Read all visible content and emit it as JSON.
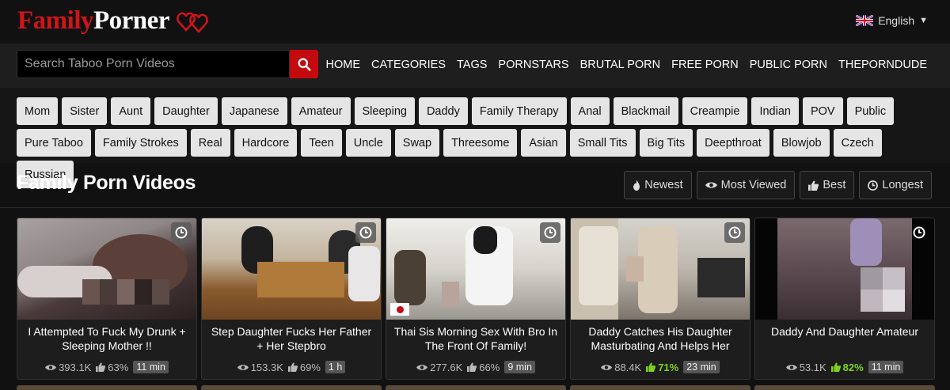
{
  "site": {
    "name_part1": "Family",
    "name_part2": "Porner",
    "language": "English"
  },
  "search": {
    "placeholder": "Search Taboo Porn Videos"
  },
  "nav": [
    "HOME",
    "CATEGORIES",
    "TAGS",
    "PORNSTARS",
    "BRUTAL PORN",
    "FREE PORN",
    "PUBLIC PORN",
    "THEPORNDUDE"
  ],
  "tags": [
    "Mom",
    "Sister",
    "Aunt",
    "Daughter",
    "Japanese",
    "Amateur",
    "Sleeping",
    "Daddy",
    "Family Therapy",
    "Anal",
    "Blackmail",
    "Creampie",
    "Indian",
    "POV",
    "Public",
    "Pure Taboo",
    "Family Strokes",
    "Real",
    "Hardcore",
    "Teen",
    "Uncle",
    "Swap",
    "Threesome",
    "Asian",
    "Small Tits",
    "Big Tits",
    "Deepthroat",
    "Blowjob",
    "Czech",
    "Russian"
  ],
  "section": {
    "title": "Family Porn Videos"
  },
  "sort": {
    "newest": "Newest",
    "most_viewed": "Most Viewed",
    "best": "Best",
    "longest": "Longest"
  },
  "videos": [
    {
      "title": "I Attempted To Fuck My Drunk + Sleeping Mother !!",
      "views": "393.1K",
      "rating": "63%",
      "duration": "11 min"
    },
    {
      "title": "Step Daughter Fucks Her Father + Her Stepbro",
      "views": "153.3K",
      "rating": "69%",
      "duration": "1 h"
    },
    {
      "title": "Thai Sis Morning Sex With Bro In The Front Of Family!",
      "views": "277.6K",
      "rating": "66%",
      "duration": "9 min"
    },
    {
      "title": "Daddy Catches His Daughter Masturbating And Helps Her",
      "views": "88.4K",
      "rating": "71%",
      "duration": "23 min"
    },
    {
      "title": "Daddy And Daughter Amateur",
      "views": "53.1K",
      "rating": "82%",
      "duration": "11 min"
    }
  ],
  "colors": {
    "brand_red": "#d2141a",
    "search_button": "#c4090f",
    "high_rating": "#7ed321"
  }
}
